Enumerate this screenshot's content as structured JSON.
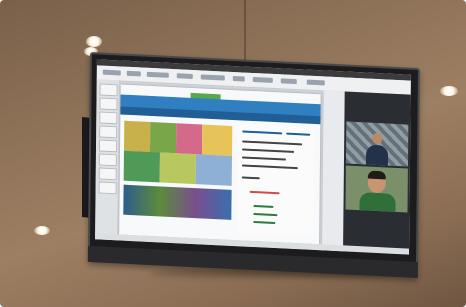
{
  "scene": {
    "description_tags": [
      "ceiling",
      "wall-mounted-tv",
      "video-conference",
      "presentation-slide"
    ]
  },
  "colors": {
    "wall": "#8e7258",
    "bezel": "#1c1c1e",
    "slide_banner": "#2f7fc1",
    "slide_banner_dark": "#215e96",
    "accent_green": "#56a84a",
    "video_bg": "#2a2e33"
  },
  "icons": [
    "ceiling-light-icon",
    "tv-icon",
    "presentation-icon",
    "video-call-icon"
  ]
}
